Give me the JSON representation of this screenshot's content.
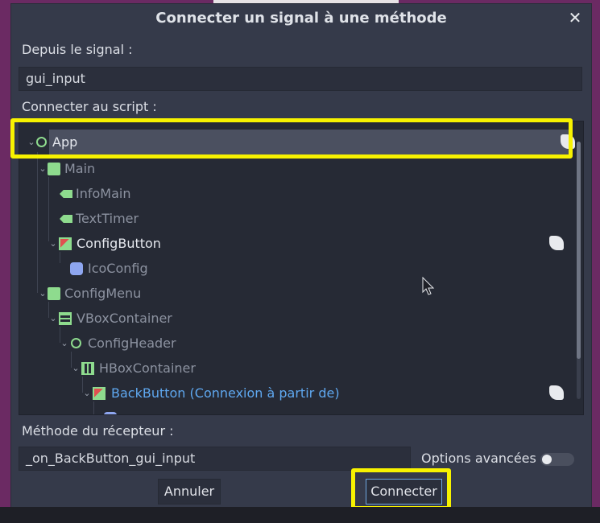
{
  "dialog": {
    "title": "Connecter un signal à une méthode",
    "close_label": "✕"
  },
  "signal": {
    "label": "Depuis le signal :",
    "value": "gui_input"
  },
  "script": {
    "label": "Connecter au script :"
  },
  "tree": {
    "items": [
      {
        "label": "App",
        "icon": "control-circle-icon",
        "color": "#8edb8e",
        "has_script": true
      },
      {
        "label": "Main",
        "icon": "panel-icon",
        "color": "#8edb8e",
        "has_script": false
      },
      {
        "label": "InfoMain",
        "icon": "label-icon",
        "color": "#8edb8e",
        "has_script": false
      },
      {
        "label": "TextTimer",
        "icon": "label-icon",
        "color": "#8edb8e",
        "has_script": false
      },
      {
        "label": "ConfigButton",
        "icon": "texture-button-icon",
        "color": "#8edb8e",
        "has_script": true
      },
      {
        "label": "IcoConfig",
        "icon": "sprite-icon",
        "color": "#8ea6f0",
        "has_script": false
      },
      {
        "label": "ConfigMenu",
        "icon": "panel-icon",
        "color": "#8edb8e",
        "has_script": false
      },
      {
        "label": "VBoxContainer",
        "icon": "vbox-icon",
        "color": "#8edb8e",
        "has_script": false
      },
      {
        "label": "ConfigHeader",
        "icon": "control-circle-icon",
        "color": "#8edb8e",
        "has_script": false
      },
      {
        "label": "HBoxContainer",
        "icon": "hbox-icon",
        "color": "#8edb8e",
        "has_script": false
      },
      {
        "label": "BackButton (Connexion à partir de)",
        "icon": "texture-button-icon",
        "color": "#5fa8f0",
        "has_script": true
      }
    ]
  },
  "method": {
    "label": "Méthode du récepteur :",
    "value": "_on_BackButton_gui_input"
  },
  "advanced": {
    "label": "Options avancées",
    "enabled": false
  },
  "buttons": {
    "cancel": "Annuler",
    "connect": "Connecter"
  },
  "colors": {
    "highlight": "#f7f200",
    "accent_blue": "#5fa8f0",
    "node_green": "#8edb8e"
  }
}
